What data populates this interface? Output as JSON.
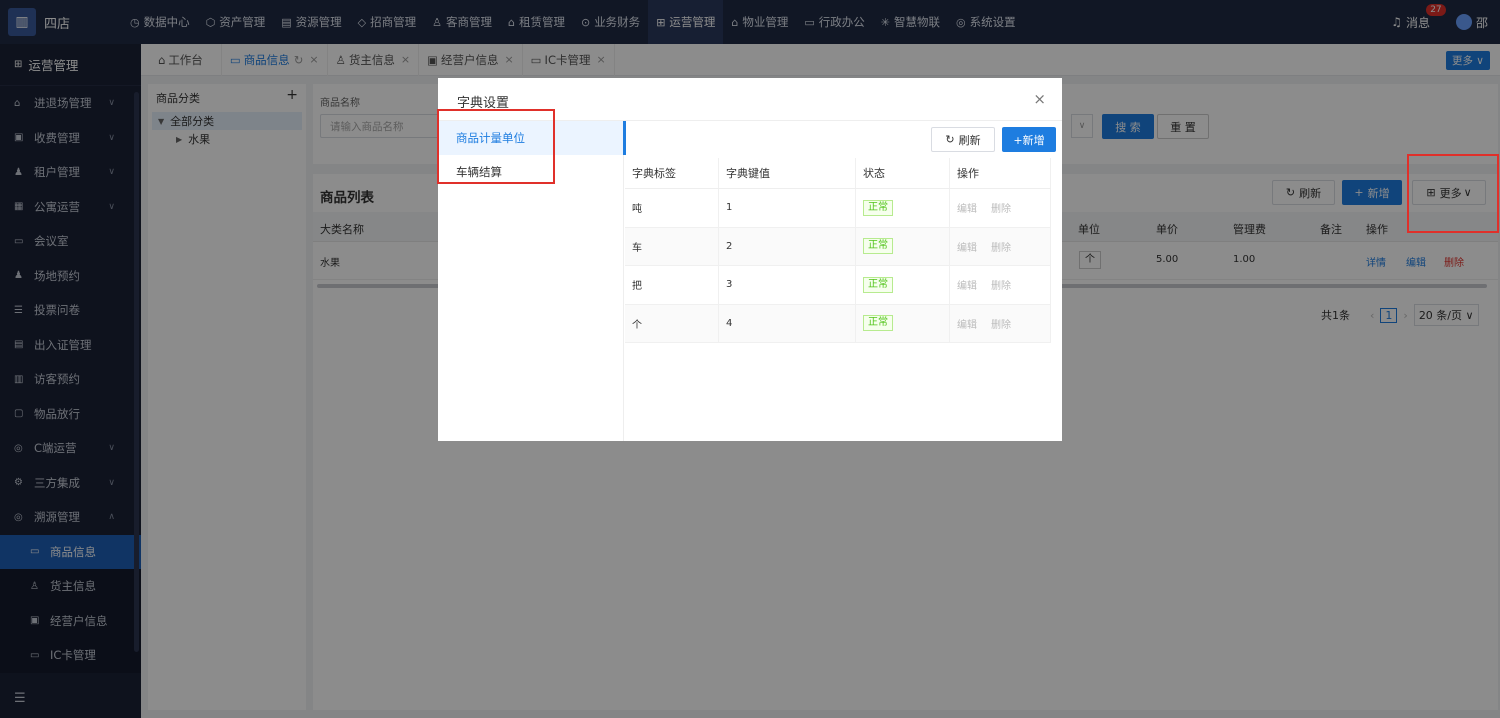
{
  "brand": "四店",
  "nav": [
    "数据中心",
    "资产管理",
    "资源管理",
    "招商管理",
    "客商管理",
    "租赁管理",
    "业务财务",
    "运营管理",
    "物业管理",
    "行政办公",
    "智慧物联",
    "系统设置"
  ],
  "nav_icons": [
    "◷",
    "⬡",
    "▤",
    "◇",
    "♙",
    "⌂",
    "⊙",
    "⊞",
    "⌂",
    "▭",
    "✳",
    "◎"
  ],
  "topright": {
    "msg": "消息",
    "badge": "27",
    "user": "邵"
  },
  "sidebar": {
    "head": "运营管理",
    "items": [
      {
        "label": "进退场管理",
        "chev": "∨"
      },
      {
        "label": "收费管理",
        "chev": "∨"
      },
      {
        "label": "租户管理",
        "chev": "∨"
      },
      {
        "label": "公寓运营",
        "chev": "∨"
      },
      {
        "label": "会议室",
        "chev": ""
      },
      {
        "label": "场地预约",
        "chev": ""
      },
      {
        "label": "投票问卷",
        "chev": ""
      },
      {
        "label": "出入证管理",
        "chev": ""
      },
      {
        "label": "访客预约",
        "chev": ""
      },
      {
        "label": "物品放行",
        "chev": ""
      },
      {
        "label": "C端运营",
        "chev": "∨"
      },
      {
        "label": "三方集成",
        "chev": "∨"
      },
      {
        "label": "溯源管理",
        "chev": "∧"
      }
    ],
    "subs": [
      "商品信息",
      "货主信息",
      "经营户信息",
      "IC卡管理"
    ]
  },
  "tabs": [
    "工作台",
    "商品信息",
    "货主信息",
    "经营户信息",
    "IC卡管理"
  ],
  "more_tab": "更多 ∨",
  "left": {
    "title": "商品分类",
    "plus": "+",
    "root": "全部分类",
    "child": "水果"
  },
  "search": {
    "label": "商品名称",
    "placeholder": "请输入商品名称",
    "search_btn": "搜 索",
    "reset_btn": "重 置"
  },
  "list": {
    "title": "商品列表",
    "refresh": "刷新",
    "add": "新增",
    "more": "更多",
    "headers": {
      "c0": "大类名称",
      "c1": "单位",
      "c2": "单价",
      "c3": "管理费",
      "c4": "备注",
      "c5": "操作"
    },
    "row": {
      "cat": "水果",
      "unit": "个",
      "price": "5.00",
      "fee": "1.00",
      "detail": "详情",
      "edit": "编辑",
      "del": "删除"
    },
    "total": "共1条",
    "page": "1",
    "pagesize": "20 条/页 ∨"
  },
  "modal": {
    "title": "字典设置",
    "close": "×",
    "side": [
      "商品计量单位",
      "车辆结算"
    ],
    "refresh": "刷新",
    "add": "+新增",
    "headers": [
      "字典标签",
      "字典键值",
      "状态",
      "操作"
    ],
    "rows": [
      {
        "label": "吨",
        "key": "1",
        "status": "正常"
      },
      {
        "label": "车",
        "key": "2",
        "status": "正常"
      },
      {
        "label": "把",
        "key": "3",
        "status": "正常"
      },
      {
        "label": "个",
        "key": "4",
        "status": "正常"
      }
    ],
    "op_edit": "编辑",
    "op_del": "删除"
  }
}
